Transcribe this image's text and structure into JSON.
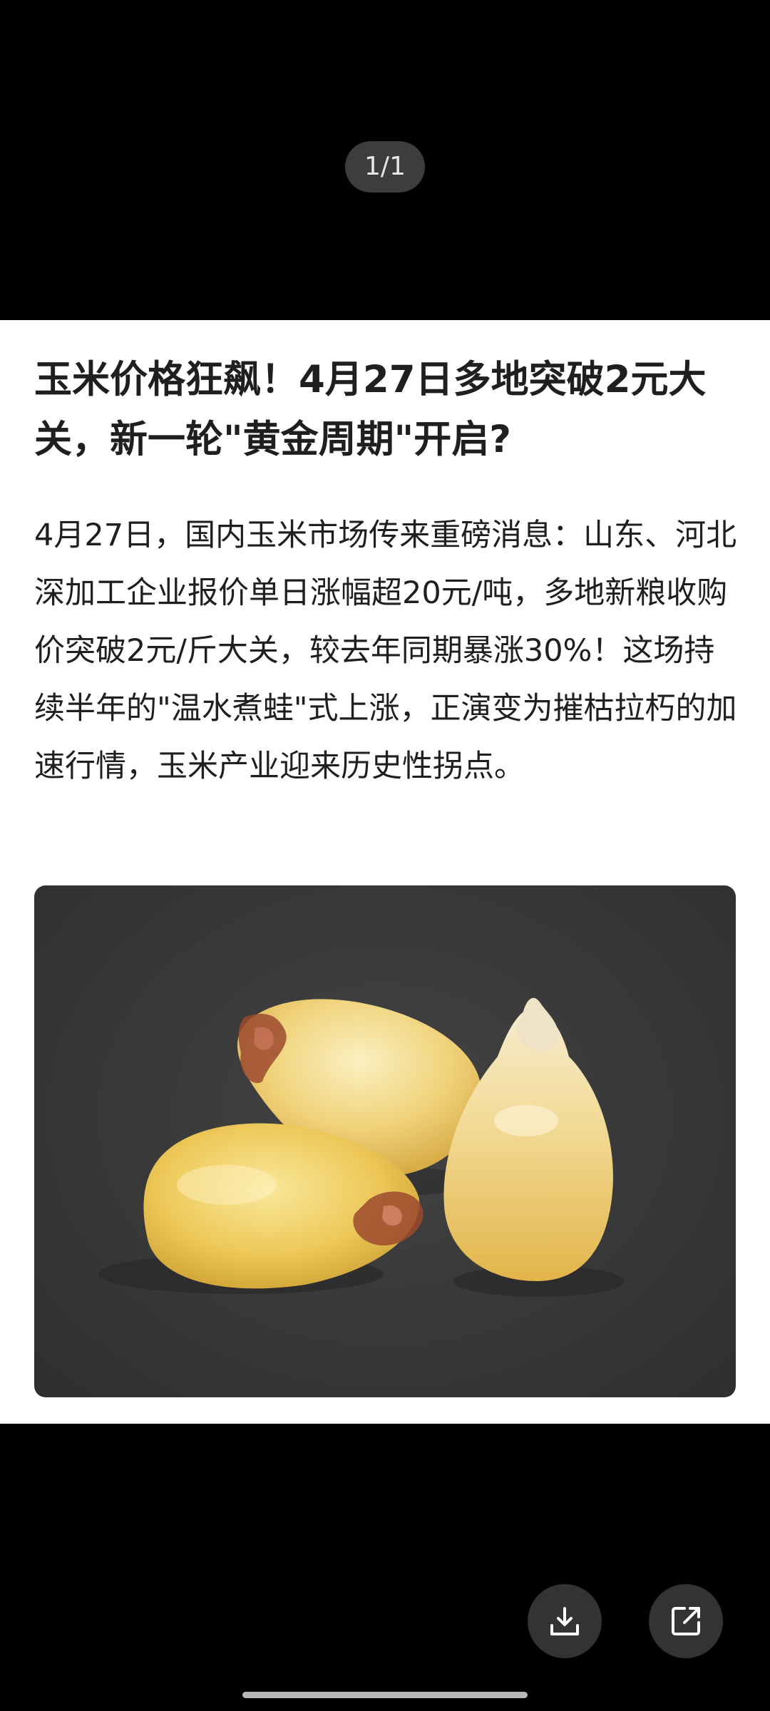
{
  "viewer": {
    "counter": "1/1"
  },
  "article": {
    "title": "玉米价格狂飙！4月27日多地突破2元大关，新一轮\"黄金周期\"开启?",
    "body": "4月27日，国内玉米市场传来重磅消息：山东、河北深加工企业报价单日涨幅超20元/吨，多地新粮收购价突破2元/斤大关，较去年同期暴涨30%！这场持续半年的\"温水煮蛙\"式上涨，正演变为摧枯拉朽的加速行情，玉米产业迎来历史性拐点。",
    "image_icon": "corn-kernels-photo"
  },
  "actions": {
    "download_icon": "download-icon",
    "share_icon": "share-icon"
  },
  "colors": {
    "background": "#000000",
    "card": "#ffffff",
    "text": "#1f1f1f",
    "button": "#333333"
  }
}
